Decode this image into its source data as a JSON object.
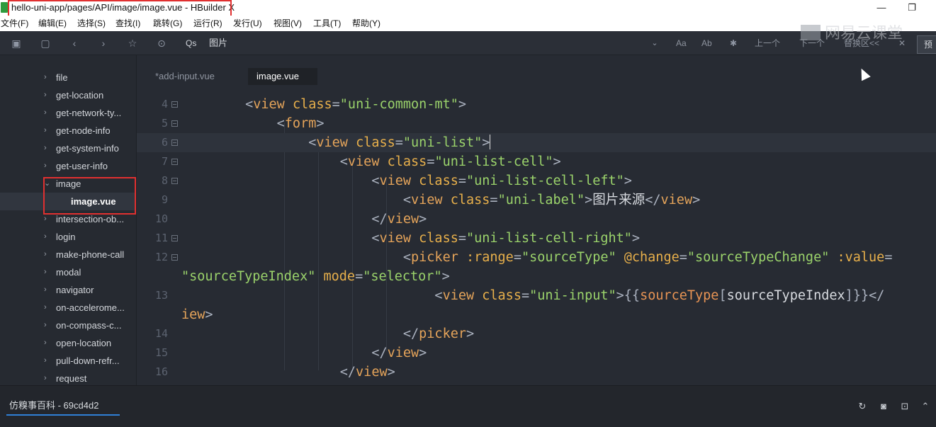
{
  "window": {
    "title": "hello-uni-app/pages/API/image/image.vue - HBuilder X",
    "minimize_glyph": "—",
    "maximize_glyph": "❐"
  },
  "menu": [
    {
      "label": "文件(F)"
    },
    {
      "label": "编辑(E)"
    },
    {
      "label": "选择(S)"
    },
    {
      "label": "查找(I)"
    },
    {
      "label": "跳转(G)"
    },
    {
      "label": "运行(R)"
    },
    {
      "label": "发行(U)"
    },
    {
      "label": "视图(V)"
    },
    {
      "label": "工具(T)"
    },
    {
      "label": "帮助(Y)"
    }
  ],
  "toolbar": {
    "search_icon_text": "Qs",
    "search_value": "图片",
    "match_case": "Aa",
    "whole_word": "Ab",
    "prev_label": "上一个",
    "next_label": "下一个",
    "replace_label": "替换区<<",
    "close_glyph": "✕",
    "preview_label": "预",
    "watermark": "网易云课堂"
  },
  "sidebar": {
    "items": [
      {
        "label": "file",
        "arrow": "›"
      },
      {
        "label": "get-location",
        "arrow": "›"
      },
      {
        "label": "get-network-ty...",
        "arrow": "›"
      },
      {
        "label": "get-node-info",
        "arrow": "›"
      },
      {
        "label": "get-system-info",
        "arrow": "›"
      },
      {
        "label": "get-user-info",
        "arrow": "›"
      },
      {
        "label": "image",
        "arrow": "⌄"
      },
      {
        "label": "image.vue",
        "arrow": ""
      },
      {
        "label": "intersection-ob...",
        "arrow": "›"
      },
      {
        "label": "login",
        "arrow": "›"
      },
      {
        "label": "make-phone-call",
        "arrow": "›"
      },
      {
        "label": "modal",
        "arrow": "›"
      },
      {
        "label": "navigator",
        "arrow": "›"
      },
      {
        "label": "on-accelerome...",
        "arrow": "›"
      },
      {
        "label": "on-compass-c...",
        "arrow": "›"
      },
      {
        "label": "open-location",
        "arrow": "›"
      },
      {
        "label": "pull-down-refr...",
        "arrow": "›"
      },
      {
        "label": "request",
        "arrow": "›"
      }
    ]
  },
  "editor": {
    "tabs": [
      {
        "label": "*add-input.vue",
        "active": false
      },
      {
        "label": "image.vue",
        "active": true
      }
    ],
    "lines": [
      {
        "num": "4"
      },
      {
        "num": "5"
      },
      {
        "num": "6"
      },
      {
        "num": "7"
      },
      {
        "num": "8"
      },
      {
        "num": "9"
      },
      {
        "num": "10"
      },
      {
        "num": "11"
      },
      {
        "num": "12"
      },
      {
        "num": ""
      },
      {
        "num": "13"
      },
      {
        "num": ""
      },
      {
        "num": "14"
      },
      {
        "num": "15"
      },
      {
        "num": "16"
      }
    ],
    "tokens": {
      "lt": "<",
      "gt": ">",
      "lt_slash": "</",
      "eq": "=",
      "view": "view",
      "form": "form",
      "picker": "picker",
      "class": "class",
      "range": ":range",
      "change": "@change",
      "value": ":value",
      "mode": "mode",
      "s_common_mt": "\"uni-common-mt\"",
      "s_list": "\"uni-list\"",
      "s_list_cell": "\"uni-list-cell\"",
      "s_cell_left": "\"uni-list-cell-left\"",
      "s_label": "\"uni-label\"",
      "s_cell_right": "\"uni-list-cell-right\"",
      "s_source_type": "\"sourceType\"",
      "s_source_change": "\"sourceTypeChange\"",
      "s_source_index_wrap": "\"sourceTypeIndex\"",
      "s_selector": "\"selector\"",
      "s_input": "\"uni-input\"",
      "label_text": "图片来源",
      "mustache_open": "{{",
      "mustache_close": "}}",
      "bind_source": "sourceType",
      "bracket_open": "[",
      "bracket_close": "]",
      "bind_index": "sourceTypeIndex",
      "tail_lt_slash": "</",
      "wrap_iew": "iew"
    }
  },
  "statusbar": {
    "text": "仿糗事百科 - 69cd4d2"
  }
}
